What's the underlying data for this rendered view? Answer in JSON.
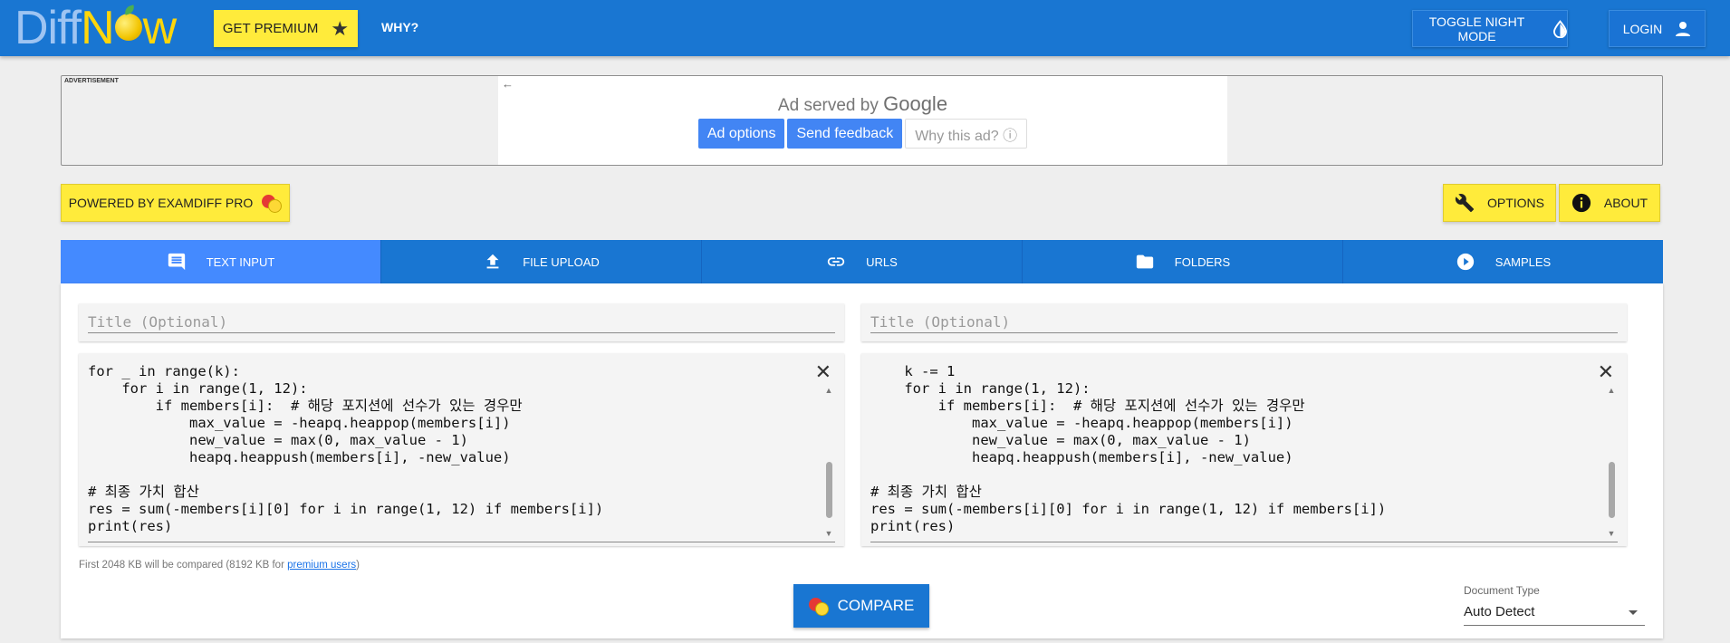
{
  "header": {
    "logo_diff": "Diff",
    "logo_n": "N",
    "logo_w": "w",
    "premium_label": "GET PREMIUM",
    "why_label": "WHY?",
    "night_mode_label": "TOGGLE NIGHT MODE",
    "login_label": "LOGIN",
    "color_primary": "#1976d2",
    "color_accent": "#ffeb3b"
  },
  "ad": {
    "label": "ADVERTISEMENT",
    "served_by": "Ad served by",
    "google": "Google",
    "options_label": "Ad options",
    "feedback_label": "Send feedback",
    "why_label": "Why this ad? ⓘ"
  },
  "toolbar": {
    "powered_label": "POWERED BY EXAMDIFF PRO",
    "options_label": "OPTIONS",
    "about_label": "ABOUT"
  },
  "tabs": [
    {
      "label": "TEXT INPUT",
      "icon": "comment-icon",
      "active": true
    },
    {
      "label": "FILE UPLOAD",
      "icon": "upload-icon",
      "active": false
    },
    {
      "label": "URLS",
      "icon": "link-icon",
      "active": false
    },
    {
      "label": "FOLDERS",
      "icon": "folder-icon",
      "active": false
    },
    {
      "label": "SAMPLES",
      "icon": "play-circle-icon",
      "active": false
    }
  ],
  "editor": {
    "left": {
      "title_placeholder": "Title (Optional)",
      "code": "for _ in range(k):\n    for i in range(1, 12):\n        if members[i]:  # 해당 포지션에 선수가 있는 경우만\n            max_value = -heapq.heappop(members[i])\n            new_value = max(0, max_value - 1)\n            heapq.heappush(members[i], -new_value)\n\n# 최종 가치 합산\nres = sum(-members[i][0] for i in range(1, 12) if members[i])\nprint(res)"
    },
    "right": {
      "title_placeholder": "Title (Optional)",
      "code": "    k -= 1\n    for i in range(1, 12):\n        if members[i]:  # 해당 포지션에 선수가 있는 경우만\n            max_value = -heapq.heappop(members[i])\n            new_value = max(0, max_value - 1)\n            heapq.heappush(members[i], -new_value)\n\n# 최종 가치 합산\nres = sum(-members[i][0] for i in range(1, 12) if members[i])\nprint(res)"
    }
  },
  "limit_note": {
    "prefix": "First 2048 KB will be compared (8192 KB for ",
    "link": "premium users",
    "suffix": ")"
  },
  "compare_label": "COMPARE",
  "document_type": {
    "label": "Document Type",
    "selected": "Auto Detect"
  }
}
